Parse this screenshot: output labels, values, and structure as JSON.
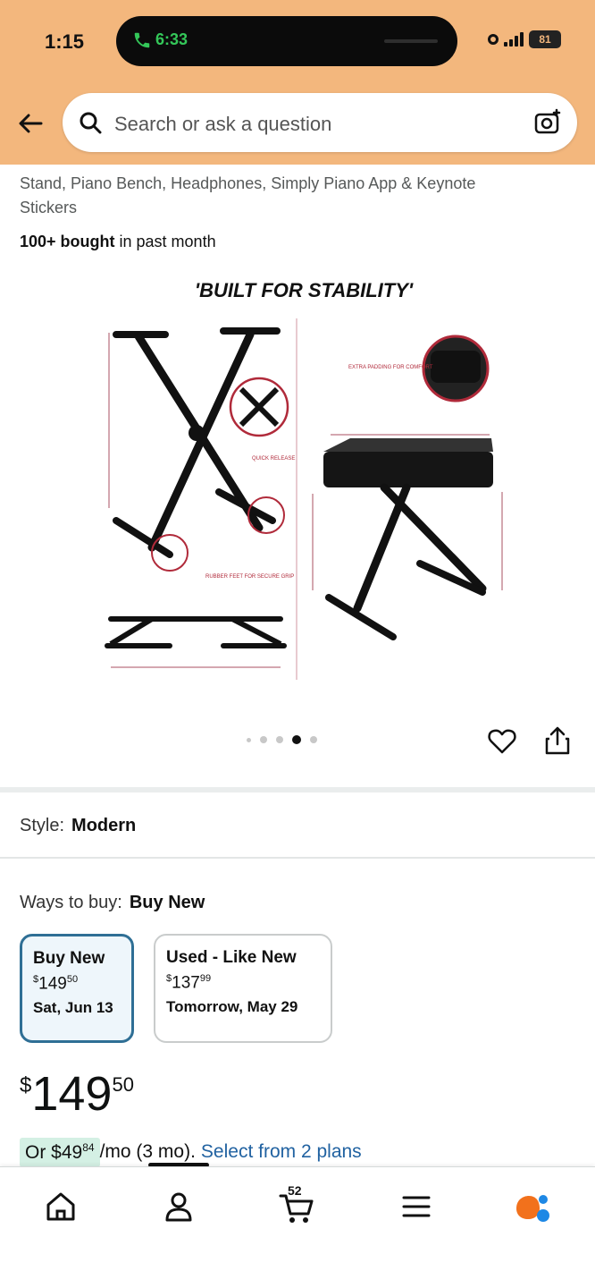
{
  "status_bar": {
    "time": "1:15",
    "call_time": "6:33",
    "battery": "81"
  },
  "search": {
    "placeholder": "Search or ask a question"
  },
  "product": {
    "title_line1": "Stand, Piano Bench, Headphones, Simply Piano App & Keynote",
    "title_line2": "Stickers",
    "bought_bold": "100+ bought",
    "bought_rest": " in past month",
    "image_heading": "'BUILT FOR STABILITY'",
    "image_dots_total": 5,
    "image_dots_active": 4
  },
  "style": {
    "label": "Style:",
    "value": "Modern"
  },
  "ways_to_buy": {
    "label": "Ways to buy:",
    "value": "Buy New",
    "options": [
      {
        "title": "Buy New",
        "price_currency": "$",
        "price_whole": "149",
        "price_frac": "50",
        "date": "Sat, Jun 13"
      },
      {
        "title": "Used - Like New",
        "price_currency": "$",
        "price_whole": "137",
        "price_frac": "99",
        "date": "Tomorrow, May 29"
      }
    ]
  },
  "price": {
    "currency": "$",
    "whole": "149",
    "fraction": "50"
  },
  "monthly": {
    "prefix": "Or $",
    "whole": "49",
    "fraction": "84",
    "term": " /mo (3 mo).",
    "link": "Select from 2 plans"
  },
  "bottom_nav": {
    "cart_count": "52",
    "items": [
      "home-icon",
      "account-icon",
      "cart-icon",
      "menu-icon",
      "rufus-icon"
    ]
  },
  "colors": {
    "header_bg": "#f3b77d",
    "link": "#2162a1",
    "selected_border": "#2f6f95",
    "monthly_bg": "#d4f0e4"
  }
}
